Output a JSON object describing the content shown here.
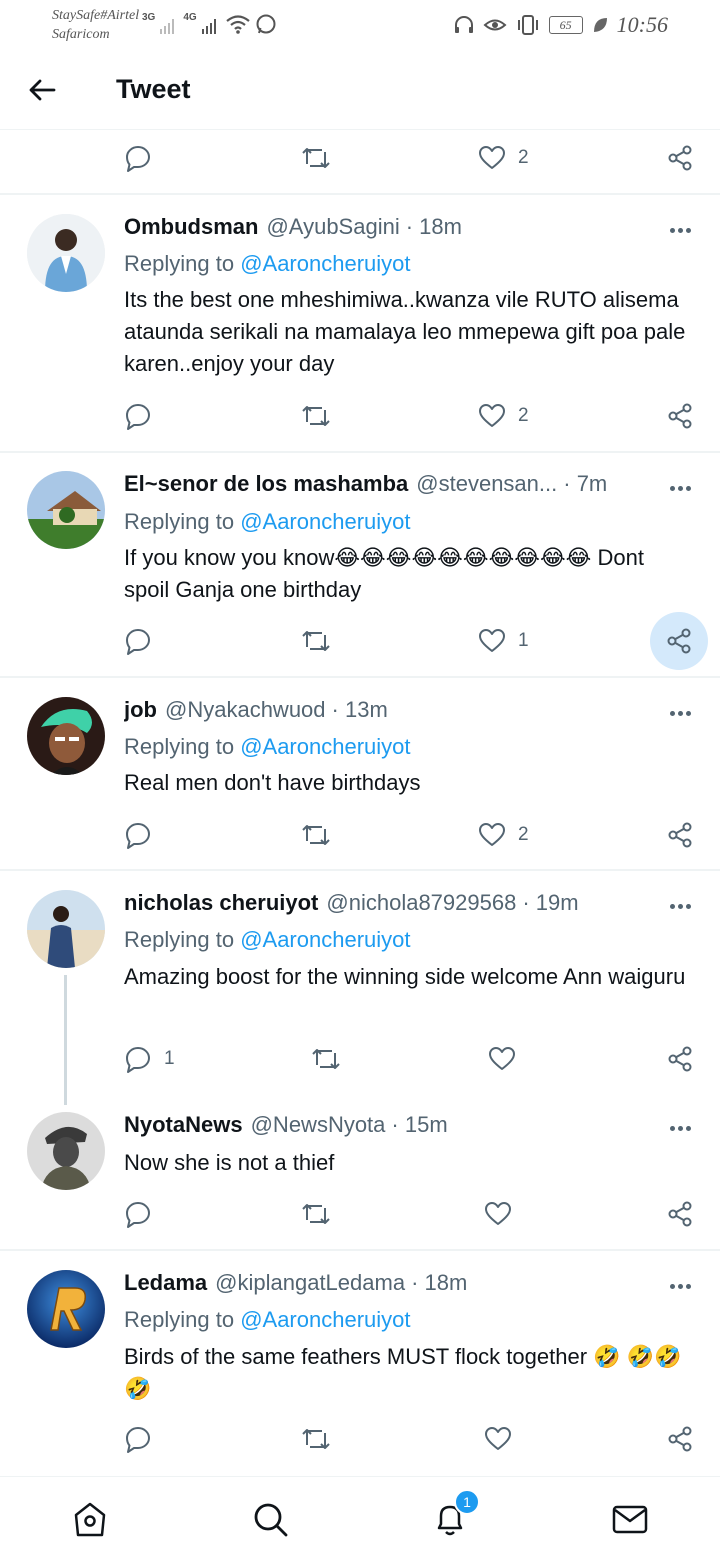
{
  "status_bar": {
    "carrier_line1": "StaySafe#Airtel",
    "carrier_line2": "Safaricom",
    "net1": "3G",
    "net2": "4G",
    "battery": "65",
    "time": "10:56"
  },
  "header": {
    "title": "Tweet",
    "back_icon": "arrow-left-icon"
  },
  "top_actions": {
    "like_count": "2"
  },
  "tweets": [
    {
      "name": "Ombudsman",
      "handle": "@AyubSagini",
      "time": "· 18m",
      "replying_prefix": "Replying to ",
      "replying_to": "@Aaroncheruiyot",
      "text": "Its the best one mheshimiwa..kwanza vile RUTO alisema ataunda serikali na mamalaya leo mmepewa gift poa pale karen..enjoy your day",
      "like_count": "2"
    },
    {
      "name": "El~senor de los mashamba",
      "handle": "@stevensan...",
      "time": "· 7m",
      "replying_prefix": "Replying to ",
      "replying_to": "@Aaroncheruiyot",
      "text": "If you know you know😂😂😂😂😂😂😂😂😂😂 Dont spoil Ganja one birthday",
      "like_count": "1"
    },
    {
      "name": "job",
      "handle": "@Nyakachwuod",
      "time": "· 13m",
      "replying_prefix": "Replying to ",
      "replying_to": "@Aaroncheruiyot",
      "text": "Real men don't have birthdays",
      "like_count": "2"
    },
    {
      "name": "nicholas cheruiyot",
      "handle": "@nichola87929568",
      "time": "· 19m",
      "replying_prefix": "Replying to ",
      "replying_to": "@Aaroncheruiyot",
      "text": "Amazing boost for the winning side welcome Ann waiguru",
      "reply_count": "1"
    },
    {
      "name": "NyotaNews",
      "handle": "@NewsNyota",
      "time": "· 15m",
      "text": "Now she is not a thief"
    },
    {
      "name": "Ledama",
      "handle": "@kiplangatLedama",
      "time": "· 18m",
      "replying_prefix": "Replying to ",
      "replying_to": "@Aaroncheruiyot",
      "text": "Birds of the same feathers MUST flock together 🤣 🤣🤣🤣"
    }
  ],
  "bottom_nav": {
    "notifications_badge": "1"
  },
  "colors": {
    "accent": "#1d9bf0",
    "text": "#0f1419",
    "muted": "#536471",
    "divider": "#eff3f4"
  }
}
